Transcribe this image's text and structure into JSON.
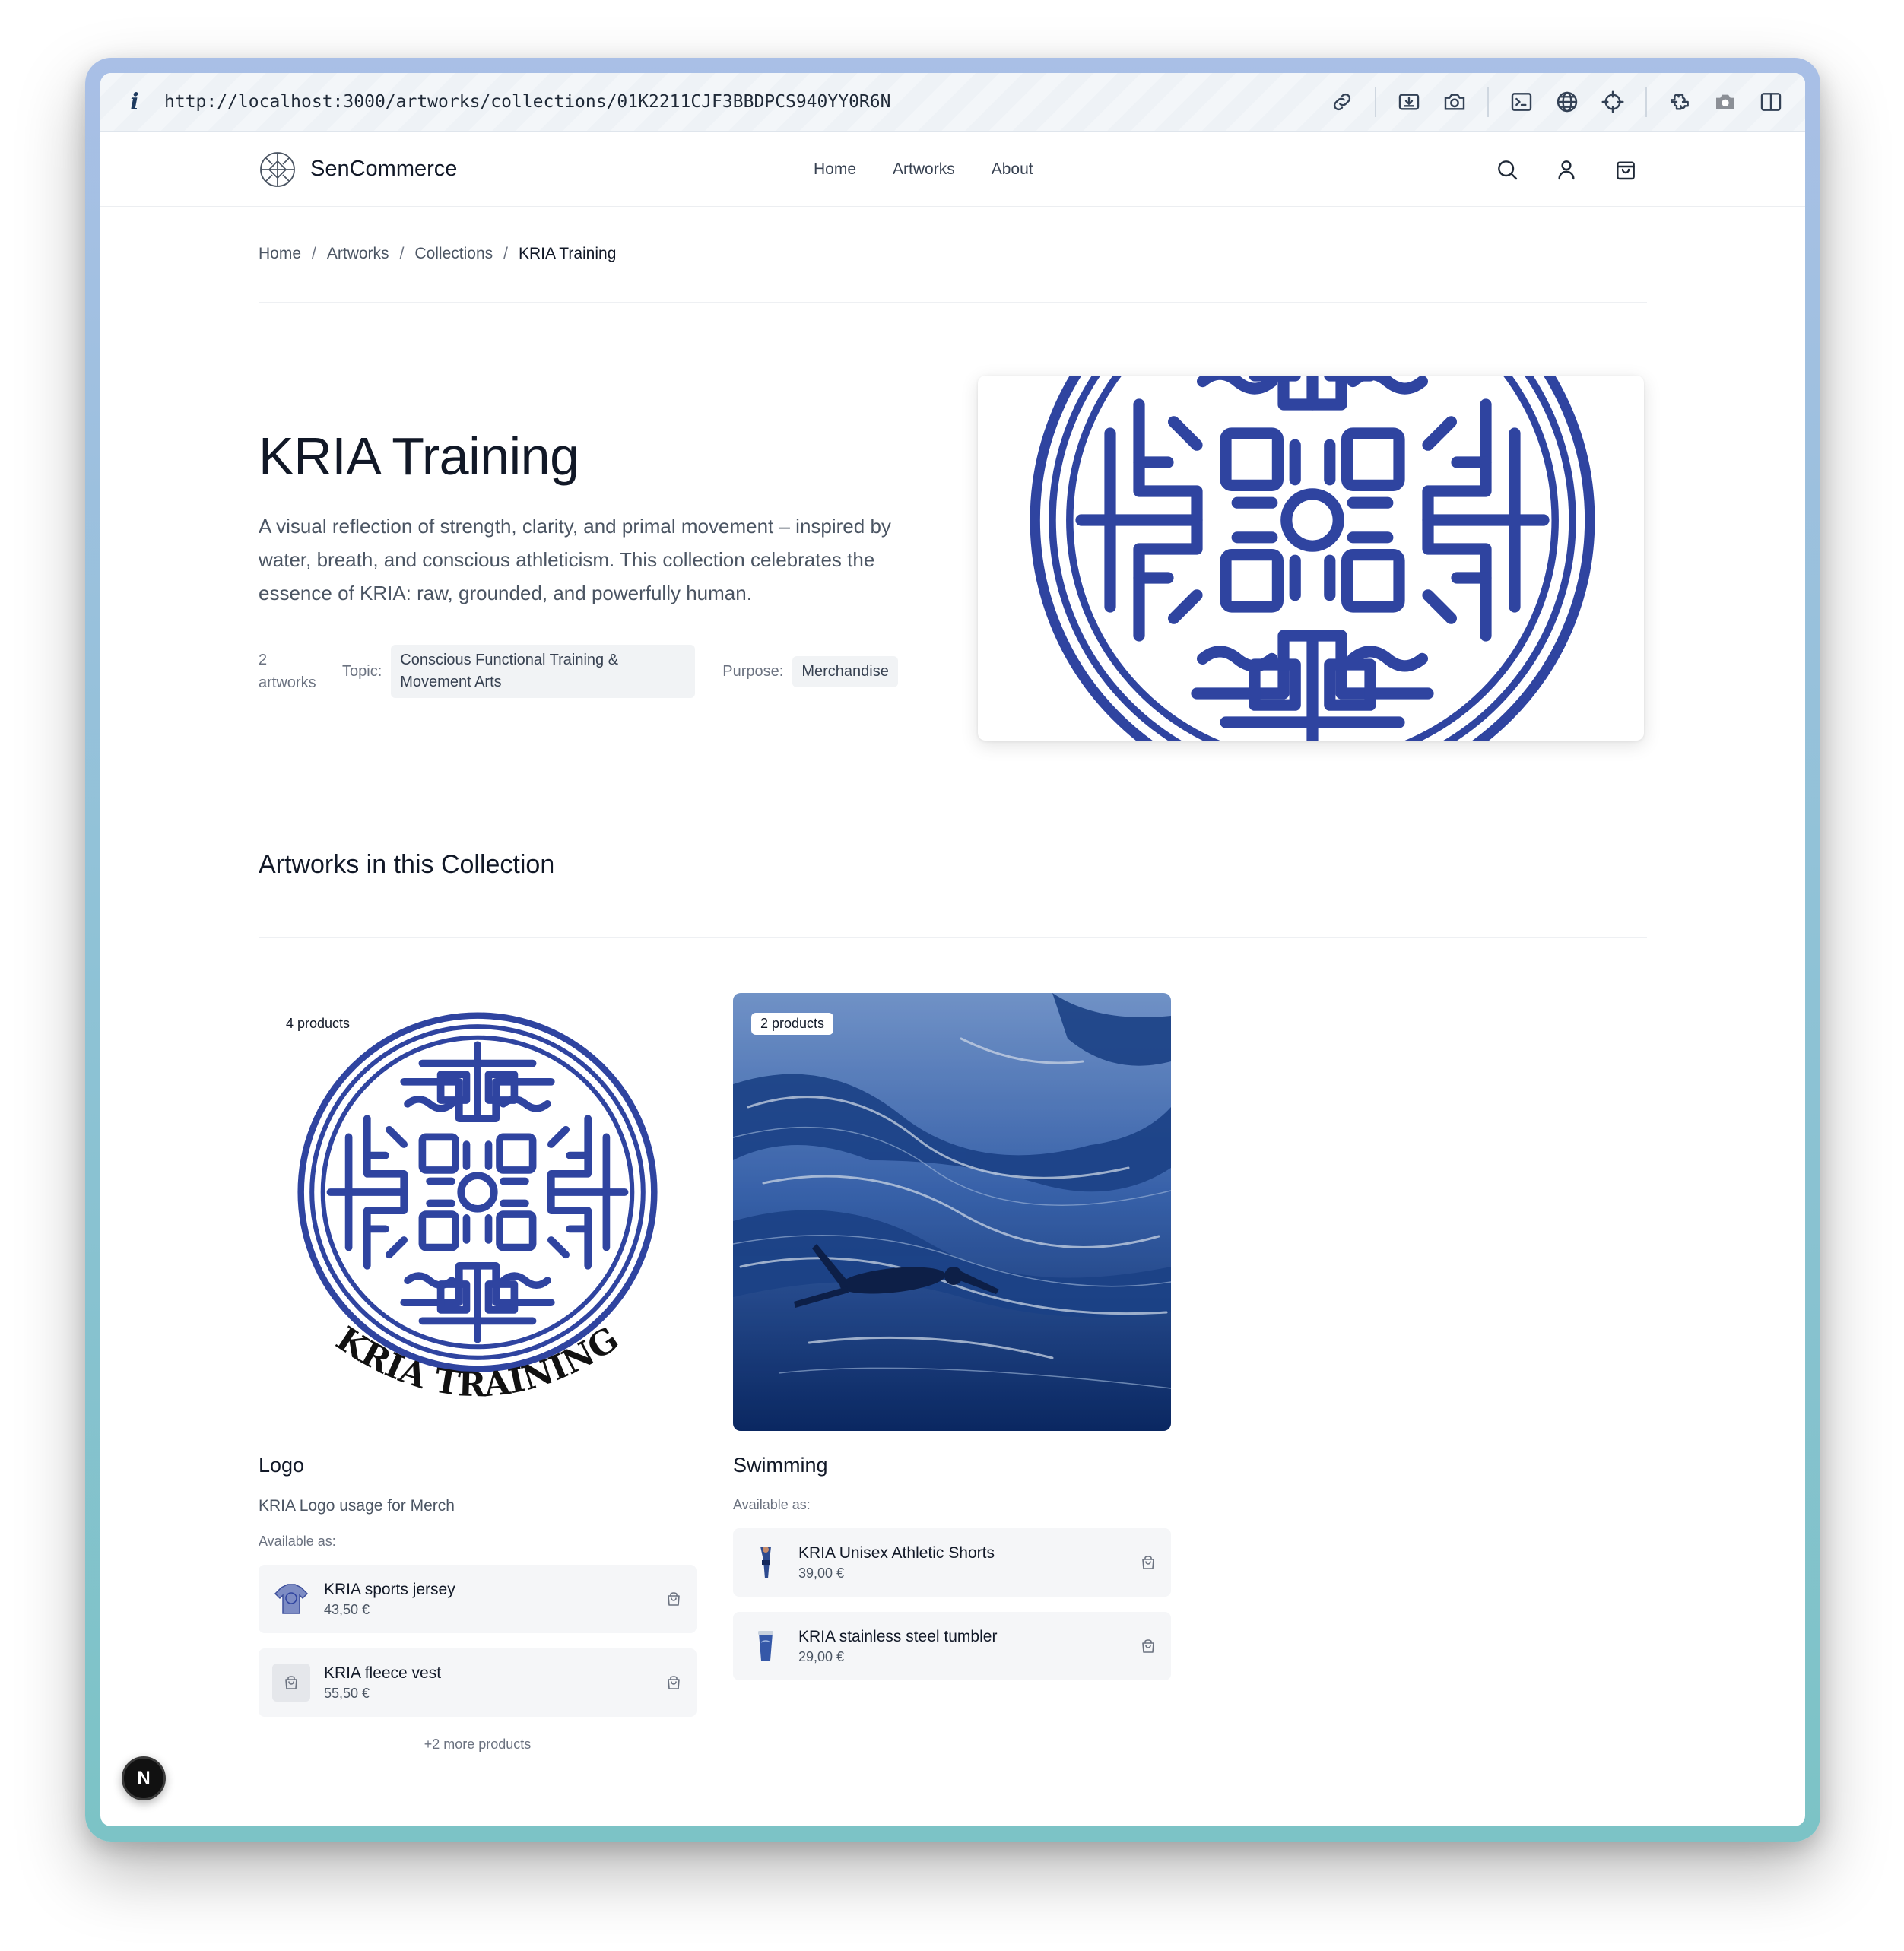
{
  "browser": {
    "url": "http://localhost:3000/artworks/collections/01K2211CJF3BBDPCS940YY0R6N"
  },
  "header": {
    "brand": "SenCommerce",
    "nav": [
      "Home",
      "Artworks",
      "About"
    ]
  },
  "breadcrumb": {
    "items": [
      "Home",
      "Artworks",
      "Collections"
    ],
    "current": "KRIA Training",
    "separator": "/"
  },
  "collection": {
    "title": "KRIA Training",
    "description": "A visual reflection of strength, clarity, and primal movement – inspired by water, breath, and conscious athleticism. This collection celebrates the essence of KRIA: raw, grounded, and powerfully human.",
    "count_number": "2",
    "count_word": "artworks",
    "topic_label": "Topic:",
    "topic": "Conscious Functional Training & Movement Arts",
    "purpose_label": "Purpose:",
    "purpose": "Merchandise"
  },
  "section_title": "Artworks in this Collection",
  "artworks": [
    {
      "badge": "4 products",
      "title": "Logo",
      "description": "KRIA Logo usage for Merch",
      "logo_text": "KRIA TRAINING",
      "available_label": "Available as:",
      "products": [
        {
          "name": "KRIA sports jersey",
          "price": "43,50 €"
        },
        {
          "name": "KRIA fleece vest",
          "price": "55,50 €"
        }
      ],
      "more": "+2 more products"
    },
    {
      "badge": "2 products",
      "title": "Swimming",
      "available_label": "Available as:",
      "products": [
        {
          "name": "KRIA Unisex Athletic Shorts",
          "price": "39,00 €"
        },
        {
          "name": "KRIA stainless steel tumbler",
          "price": "29,00 €"
        }
      ]
    }
  ],
  "dev_badge": "N",
  "colors": {
    "accent": "#2f44a0",
    "water_dark": "#0d2f72",
    "water_light": "#5f85c6"
  },
  "icons": {
    "toolbar": [
      "link-icon",
      "screenshot-region-icon",
      "camera-icon",
      "terminal-icon",
      "globe-icon",
      "crosshair-icon",
      "extension-icon",
      "camera-gray-icon",
      "sidebar-icon"
    ],
    "header": [
      "search-icon",
      "user-icon",
      "shopping-bag-icon"
    ]
  }
}
